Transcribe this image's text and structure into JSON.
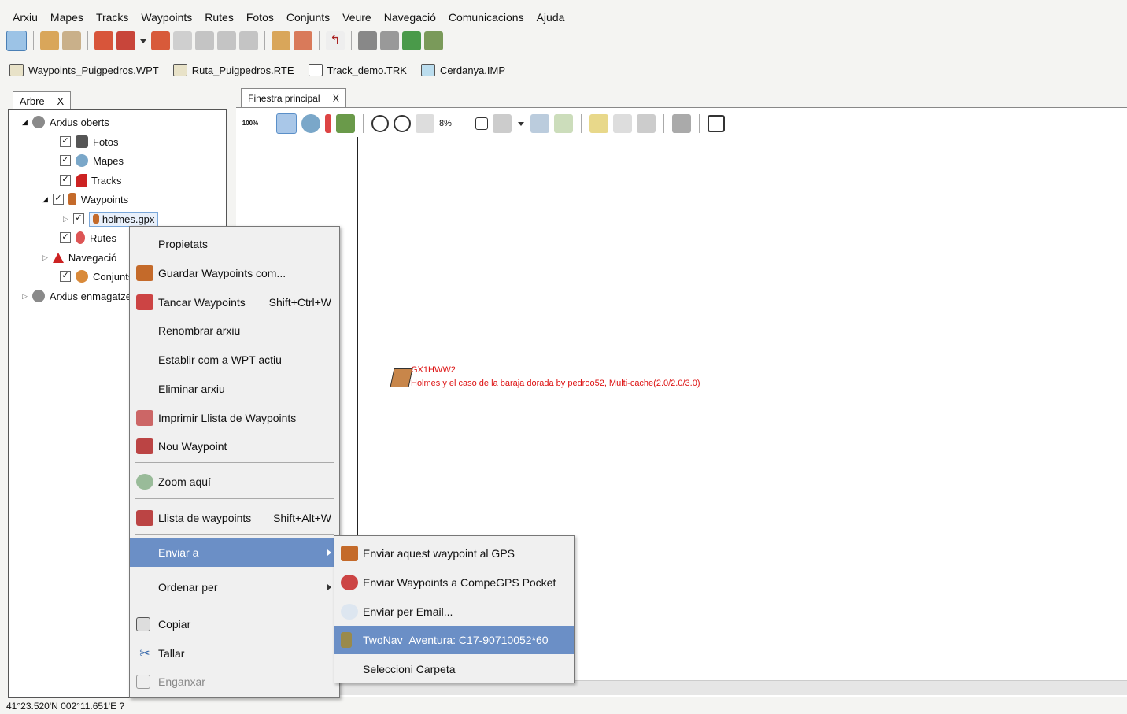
{
  "menubar": [
    "Arxiu",
    "Mapes",
    "Tracks",
    "Waypoints",
    "Rutes",
    "Fotos",
    "Conjunts",
    "Veure",
    "Navegació",
    "Comunicacions",
    "Ajuda"
  ],
  "open_files": [
    {
      "label": "Waypoints_Puigpedros.WPT",
      "icon": "folder-icon"
    },
    {
      "label": "Ruta_Puigpedros.RTE",
      "icon": "folder-icon"
    },
    {
      "label": "Track_demo.TRK",
      "icon": "track-icon"
    },
    {
      "label": "Cerdanya.IMP",
      "icon": "map-icon"
    }
  ],
  "tree_tab": {
    "label": "Arbre",
    "close": "X"
  },
  "map_tab": {
    "label": "Finestra principal",
    "close": "X"
  },
  "tree": [
    {
      "label": "Arxius oberts"
    },
    {
      "label": "Fotos"
    },
    {
      "label": "Mapes"
    },
    {
      "label": "Tracks"
    },
    {
      "label": "Waypoints"
    },
    {
      "label": "holmes.gpx"
    },
    {
      "label": "Rutes"
    },
    {
      "label": "Navegació"
    },
    {
      "label": "Conjunts"
    },
    {
      "label": "Arxius enmagatzem"
    }
  ],
  "zoom_value": "8%",
  "zoom_100_label": "100%",
  "waypoint": {
    "name": "GX1HWW2",
    "description": "Holmes y el caso de la baraja dorada by pedroo52, Multi-cache(2.0/2.0/3.0)"
  },
  "context_menu": [
    {
      "label": "Propietats",
      "shortcut": ""
    },
    {
      "label": "Guardar Waypoints com...",
      "shortcut": ""
    },
    {
      "label": "Tancar Waypoints",
      "shortcut": "Shift+Ctrl+W"
    },
    {
      "label": "Renombrar arxiu",
      "shortcut": ""
    },
    {
      "label": "Establir com a WPT actiu",
      "shortcut": ""
    },
    {
      "label": "Eliminar arxiu",
      "shortcut": ""
    },
    {
      "label": "Imprimir Llista de Waypoints",
      "shortcut": ""
    },
    {
      "label": "Nou Waypoint",
      "shortcut": ""
    },
    {
      "label": "Zoom aquí",
      "shortcut": ""
    },
    {
      "label": "Llista de waypoints",
      "shortcut": "Shift+Alt+W"
    },
    {
      "label": "Enviar a",
      "shortcut": ""
    },
    {
      "label": "Ordenar per",
      "shortcut": ""
    },
    {
      "label": "Copiar",
      "shortcut": ""
    },
    {
      "label": "Tallar",
      "shortcut": ""
    },
    {
      "label": "Enganxar",
      "shortcut": ""
    }
  ],
  "submenu": [
    {
      "label": "Enviar aquest waypoint al GPS"
    },
    {
      "label": "Enviar Waypoints a CompeGPS Pocket"
    },
    {
      "label": "Enviar per Email..."
    },
    {
      "label": "TwoNav_Aventura: C17-90710052*60"
    },
    {
      "label": "Seleccioni Carpeta"
    }
  ],
  "status": "41°23.520'N 002°11.651'E ?",
  "colors": {
    "selection": "#6b8fc6",
    "waypoint_text": "#d11111"
  }
}
